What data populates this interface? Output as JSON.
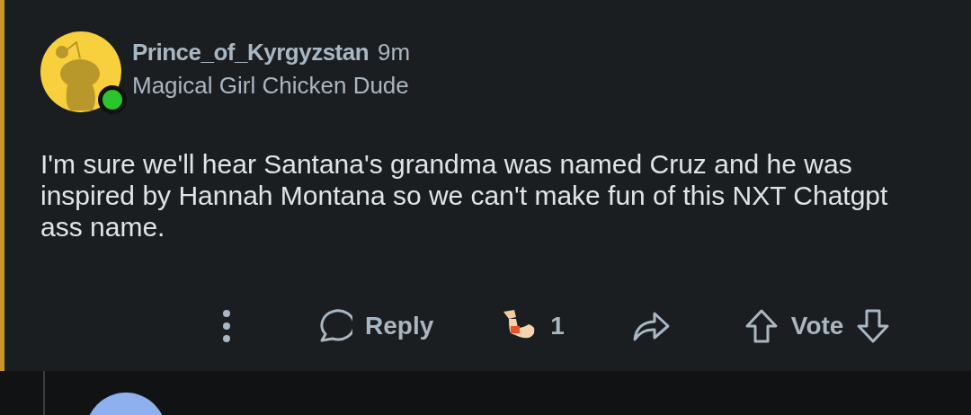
{
  "comment": {
    "author": "Prince_of_Kyrgyzstan",
    "age": "9m",
    "flair": "Magical Girl Chicken Dude",
    "online": true,
    "body": "I'm sure we'll hear Santana's grandma was named Cruz and he was inspired by Hannah Montana so we can't make fun of this NXT Chatgpt ass name.",
    "actions": {
      "reply": "Reply",
      "award_count": "1",
      "vote": "Vote"
    }
  },
  "next_comment": {
    "kind": "partial"
  }
}
